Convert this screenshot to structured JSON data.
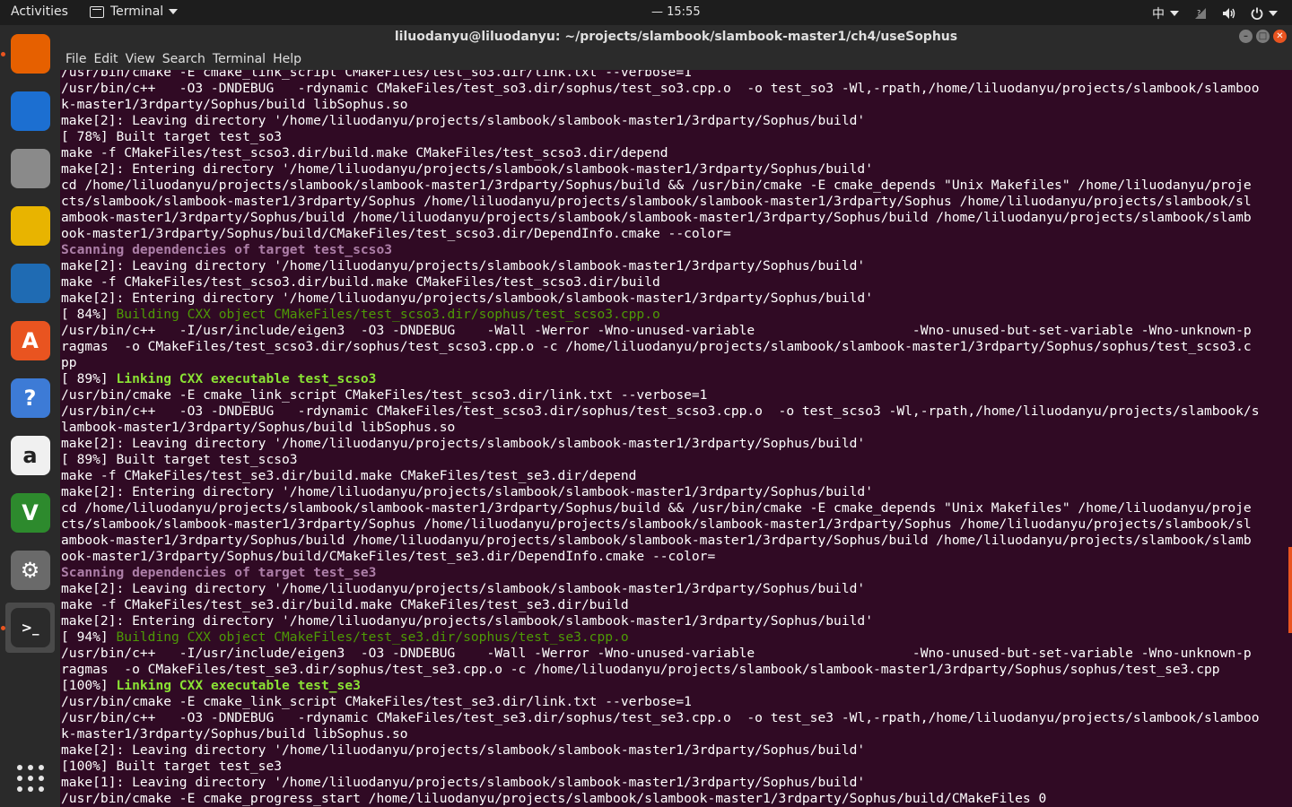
{
  "topbar": {
    "activities": "Activities",
    "app_name": "Terminal",
    "clock": "— 15:55",
    "input_method": "中",
    "tray_icons": [
      "network-icon",
      "volume-icon",
      "power-icon"
    ]
  },
  "window": {
    "title": "liluodanyu@liluodanyu: ~/projects/slambook/slambook-master1/ch4/useSophus",
    "menu": [
      "File",
      "Edit",
      "View",
      "Search",
      "Terminal",
      "Help"
    ]
  },
  "dock": [
    {
      "name": "firefox-icon",
      "glyph": "",
      "color": "#e66000",
      "running": true
    },
    {
      "name": "thunderbird-icon",
      "glyph": "",
      "color": "#1c6fd1"
    },
    {
      "name": "files-icon",
      "glyph": "",
      "color": "#8a8a8a"
    },
    {
      "name": "rhythmbox-icon",
      "glyph": "",
      "color": "#e8b400"
    },
    {
      "name": "libreoffice-writer-icon",
      "glyph": "",
      "color": "#1f6bb3"
    },
    {
      "name": "software-center-icon",
      "glyph": "A",
      "color": "#e95420"
    },
    {
      "name": "help-icon",
      "glyph": "?",
      "color": "#3d7bd6"
    },
    {
      "name": "amazon-icon",
      "glyph": "a",
      "color": "#f0f0f0"
    },
    {
      "name": "vim-icon",
      "glyph": "V",
      "color": "#2d8a2d"
    },
    {
      "name": "settings-icon",
      "glyph": "⚙",
      "color": "#6a6a6a"
    },
    {
      "name": "terminal-icon",
      "glyph": ">_",
      "color": "#2b2b2b",
      "running": true,
      "active": true
    }
  ],
  "terminal_lines": [
    {
      "text": "/usr/bin/cmake -E cmake_link_script CMakeFiles/test_so3.dir/link.txt --verbose=1"
    },
    {
      "text": "/usr/bin/c++   -O3 -DNDEBUG   -rdynamic CMakeFiles/test_so3.dir/sophus/test_so3.cpp.o  -o test_so3 -Wl,-rpath,/home/liluodanyu/projects/slambook/slamboo"
    },
    {
      "text": "k-master1/3rdparty/Sophus/build libSophus.so"
    },
    {
      "text": "make[2]: Leaving directory '/home/liluodanyu/projects/slambook/slambook-master1/3rdparty/Sophus/build'"
    },
    {
      "text": "[ 78%] Built target test_so3"
    },
    {
      "text": "make -f CMakeFiles/test_scso3.dir/build.make CMakeFiles/test_scso3.dir/depend"
    },
    {
      "text": "make[2]: Entering directory '/home/liluodanyu/projects/slambook/slambook-master1/3rdparty/Sophus/build'"
    },
    {
      "text": "cd /home/liluodanyu/projects/slambook/slambook-master1/3rdparty/Sophus/build && /usr/bin/cmake -E cmake_depends \"Unix Makefiles\" /home/liluodanyu/proje"
    },
    {
      "text": "cts/slambook/slambook-master1/3rdparty/Sophus /home/liluodanyu/projects/slambook/slambook-master1/3rdparty/Sophus /home/liluodanyu/projects/slambook/sl"
    },
    {
      "text": "ambook-master1/3rdparty/Sophus/build /home/liluodanyu/projects/slambook/slambook-master1/3rdparty/Sophus/build /home/liluodanyu/projects/slambook/slamb"
    },
    {
      "text": "ook-master1/3rdparty/Sophus/build/CMakeFiles/test_scso3.dir/DependInfo.cmake --color="
    },
    {
      "text": "Scanning dependencies of target test_scso3",
      "style": "scan"
    },
    {
      "text": "make[2]: Leaving directory '/home/liluodanyu/projects/slambook/slambook-master1/3rdparty/Sophus/build'"
    },
    {
      "text": "make -f CMakeFiles/test_scso3.dir/build.make CMakeFiles/test_scso3.dir/build"
    },
    {
      "text": "make[2]: Entering directory '/home/liluodanyu/projects/slambook/slambook-master1/3rdparty/Sophus/build'"
    },
    {
      "prefix": "[ 84%] ",
      "text": "Building CXX object CMakeFiles/test_scso3.dir/sophus/test_scso3.cpp.o",
      "style": "build"
    },
    {
      "text": "/usr/bin/c++   -I/usr/include/eigen3  -O3 -DNDEBUG    -Wall -Werror -Wno-unused-variable                    -Wno-unused-but-set-variable -Wno-unknown-p"
    },
    {
      "text": "ragmas  -o CMakeFiles/test_scso3.dir/sophus/test_scso3.cpp.o -c /home/liluodanyu/projects/slambook/slambook-master1/3rdparty/Sophus/sophus/test_scso3.c"
    },
    {
      "text": "pp"
    },
    {
      "prefix": "[ 89%] ",
      "text": "Linking CXX executable test_scso3",
      "style": "link"
    },
    {
      "text": "/usr/bin/cmake -E cmake_link_script CMakeFiles/test_scso3.dir/link.txt --verbose=1"
    },
    {
      "text": "/usr/bin/c++   -O3 -DNDEBUG   -rdynamic CMakeFiles/test_scso3.dir/sophus/test_scso3.cpp.o  -o test_scso3 -Wl,-rpath,/home/liluodanyu/projects/slambook/s"
    },
    {
      "text": "lambook-master1/3rdparty/Sophus/build libSophus.so"
    },
    {
      "text": "make[2]: Leaving directory '/home/liluodanyu/projects/slambook/slambook-master1/3rdparty/Sophus/build'"
    },
    {
      "text": "[ 89%] Built target test_scso3"
    },
    {
      "text": "make -f CMakeFiles/test_se3.dir/build.make CMakeFiles/test_se3.dir/depend"
    },
    {
      "text": "make[2]: Entering directory '/home/liluodanyu/projects/slambook/slambook-master1/3rdparty/Sophus/build'"
    },
    {
      "text": "cd /home/liluodanyu/projects/slambook/slambook-master1/3rdparty/Sophus/build && /usr/bin/cmake -E cmake_depends \"Unix Makefiles\" /home/liluodanyu/proje"
    },
    {
      "text": "cts/slambook/slambook-master1/3rdparty/Sophus /home/liluodanyu/projects/slambook/slambook-master1/3rdparty/Sophus /home/liluodanyu/projects/slambook/sl"
    },
    {
      "text": "ambook-master1/3rdparty/Sophus/build /home/liluodanyu/projects/slambook/slambook-master1/3rdparty/Sophus/build /home/liluodanyu/projects/slambook/slamb"
    },
    {
      "text": "ook-master1/3rdparty/Sophus/build/CMakeFiles/test_se3.dir/DependInfo.cmake --color="
    },
    {
      "text": "Scanning dependencies of target test_se3",
      "style": "scan"
    },
    {
      "text": "make[2]: Leaving directory '/home/liluodanyu/projects/slambook/slambook-master1/3rdparty/Sophus/build'"
    },
    {
      "text": "make -f CMakeFiles/test_se3.dir/build.make CMakeFiles/test_se3.dir/build"
    },
    {
      "text": "make[2]: Entering directory '/home/liluodanyu/projects/slambook/slambook-master1/3rdparty/Sophus/build'"
    },
    {
      "prefix": "[ 94%] ",
      "text": "Building CXX object CMakeFiles/test_se3.dir/sophus/test_se3.cpp.o",
      "style": "build"
    },
    {
      "text": "/usr/bin/c++   -I/usr/include/eigen3  -O3 -DNDEBUG    -Wall -Werror -Wno-unused-variable                    -Wno-unused-but-set-variable -Wno-unknown-p"
    },
    {
      "text": "ragmas  -o CMakeFiles/test_se3.dir/sophus/test_se3.cpp.o -c /home/liluodanyu/projects/slambook/slambook-master1/3rdparty/Sophus/sophus/test_se3.cpp"
    },
    {
      "prefix": "[100%] ",
      "text": "Linking CXX executable test_se3",
      "style": "link"
    },
    {
      "text": "/usr/bin/cmake -E cmake_link_script CMakeFiles/test_se3.dir/link.txt --verbose=1"
    },
    {
      "text": "/usr/bin/c++   -O3 -DNDEBUG   -rdynamic CMakeFiles/test_se3.dir/sophus/test_se3.cpp.o  -o test_se3 -Wl,-rpath,/home/liluodanyu/projects/slambook/slamboo"
    },
    {
      "text": "k-master1/3rdparty/Sophus/build libSophus.so"
    },
    {
      "text": "make[2]: Leaving directory '/home/liluodanyu/projects/slambook/slambook-master1/3rdparty/Sophus/build'"
    },
    {
      "text": "[100%] Built target test_se3"
    },
    {
      "text": "make[1]: Leaving directory '/home/liluodanyu/projects/slambook/slambook-master1/3rdparty/Sophus/build'"
    },
    {
      "text": "/usr/bin/cmake -E cmake_progress_start /home/liluodanyu/projects/slambook/slambook-master1/3rdparty/Sophus/build/CMakeFiles 0"
    }
  ],
  "colors": {
    "terminal_bg": "#300a24",
    "scan": "#ad7fa8",
    "build": "#4e9a06",
    "link": "#8ae234",
    "accent": "#e95420"
  }
}
